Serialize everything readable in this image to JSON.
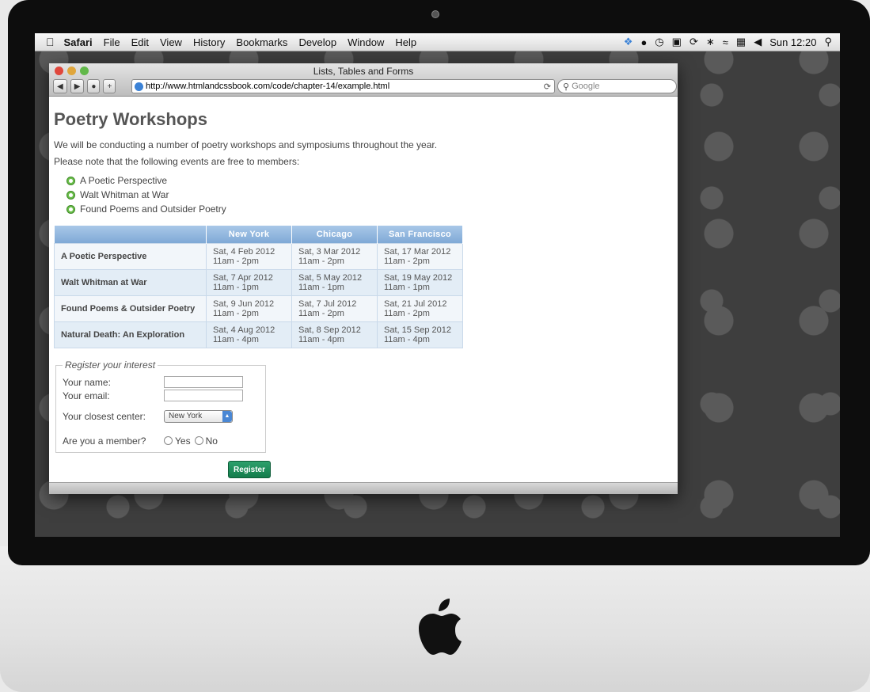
{
  "menubar": {
    "app": "Safari",
    "items": [
      "File",
      "Edit",
      "View",
      "History",
      "Bookmarks",
      "Develop",
      "Window",
      "Help"
    ],
    "clock": "Sun 12:20"
  },
  "browser": {
    "window_title": "Lists, Tables and Forms",
    "url": "http://www.htmlandcssbook.com/code/chapter-14/example.html",
    "search_placeholder": "Google"
  },
  "page": {
    "title": "Poetry Workshops",
    "intro": "We will be conducting a number of poetry workshops and symposiums throughout the year.",
    "note": "Please note that the following events are free to members:",
    "list": [
      "A Poetic Perspective",
      "Walt Whitman at War",
      "Found Poems and Outsider Poetry"
    ]
  },
  "table": {
    "headers": [
      "",
      "New York",
      "Chicago",
      "San Francisco"
    ],
    "rows": [
      {
        "event": "A Poetic Perspective",
        "cells": [
          [
            "Sat, 4 Feb 2012",
            "11am - 2pm"
          ],
          [
            "Sat, 3 Mar 2012",
            "11am - 2pm"
          ],
          [
            "Sat, 17 Mar 2012",
            "11am - 2pm"
          ]
        ]
      },
      {
        "event": "Walt Whitman at War",
        "cells": [
          [
            "Sat, 7 Apr 2012",
            "11am - 1pm"
          ],
          [
            "Sat, 5 May 2012",
            "11am - 1pm"
          ],
          [
            "Sat, 19 May 2012",
            "11am - 1pm"
          ]
        ]
      },
      {
        "event": "Found Poems & Outsider Poetry",
        "cells": [
          [
            "Sat, 9 Jun 2012",
            "11am - 2pm"
          ],
          [
            "Sat, 7 Jul 2012",
            "11am - 2pm"
          ],
          [
            "Sat, 21 Jul 2012",
            "11am - 2pm"
          ]
        ]
      },
      {
        "event": "Natural Death: An Exploration",
        "cells": [
          [
            "Sat, 4 Aug 2012",
            "11am - 4pm"
          ],
          [
            "Sat, 8 Sep 2012",
            "11am - 4pm"
          ],
          [
            "Sat, 15 Sep 2012",
            "11am - 4pm"
          ]
        ]
      }
    ]
  },
  "form": {
    "legend": "Register your interest",
    "name_label": "Your name:",
    "email_label": "Your email:",
    "center_label": "Your closest center:",
    "center_value": "New York",
    "member_label": "Are you a member?",
    "yes_label": "Yes",
    "no_label": "No",
    "submit_label": "Register"
  },
  "colors": {
    "table_header": "#7fa9d6",
    "register_button": "#137c4b",
    "bullet": "#6cbf4c"
  }
}
